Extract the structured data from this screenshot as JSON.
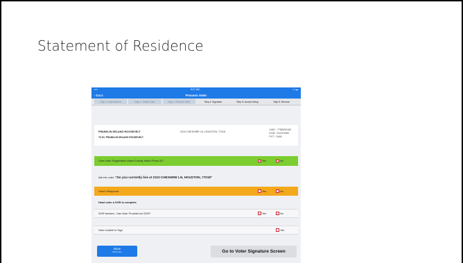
{
  "slide": {
    "title": "Statement of Residence"
  },
  "tablet": {
    "status": {
      "left": "•••• ",
      "time": "8:07 AM",
      "right": "▪ ▪ ▬"
    },
    "nav": {
      "back": "Back",
      "title": "Process Voter"
    },
    "steps": [
      "Step 1: Scan/Search",
      "Step 2: Select Voter",
      "Step 3: Process Voter",
      "Step 4: Signature",
      "Step 5: Accept Voting",
      "Step 6: Remove"
    ],
    "voter": {
      "name": "FRANKLIN DELANO ROOSEVELT",
      "tx_id": "TX ID: FRANKLIN DELANO ROOSEVELT",
      "address": "2310 CHESHIRE LN, HOUSTON, 77018",
      "vuid": "VUID : 7785000182",
      "dob": "DOB : 01/23/1982",
      "pct": "PCT : 0446"
    },
    "match_question": {
      "label": "Does Voter Registration Name Exactly Match Photo ID?",
      "yes": "Yes",
      "no": "No",
      "selected": "Yes"
    },
    "ask": {
      "prefix": "Ask the voter:",
      "question": "\"Do you currently live at 2310 CHESHIRE LN, HOUSTON, 77018\""
    },
    "response": {
      "label": "Voter's Response",
      "yes": "Yes",
      "no": "No",
      "selected": "No"
    },
    "hand_sor": "Hand voter a SOR to complete.",
    "sor_needed": {
      "label": "SOR Needed - Has Voter Provided an SOR?",
      "yes": "Yes",
      "no": "No"
    },
    "unable_sign": {
      "label": "Voter Unable to Sign",
      "yes": "Yes"
    },
    "done_button": {
      "label": "Done",
      "sub": "Start Over"
    },
    "go_button": "Go to Voter Signature Screen"
  },
  "colors": {
    "accent": "#1e7ae6",
    "match_row": "#7ccd2f",
    "response_row": "#f4a81c"
  }
}
